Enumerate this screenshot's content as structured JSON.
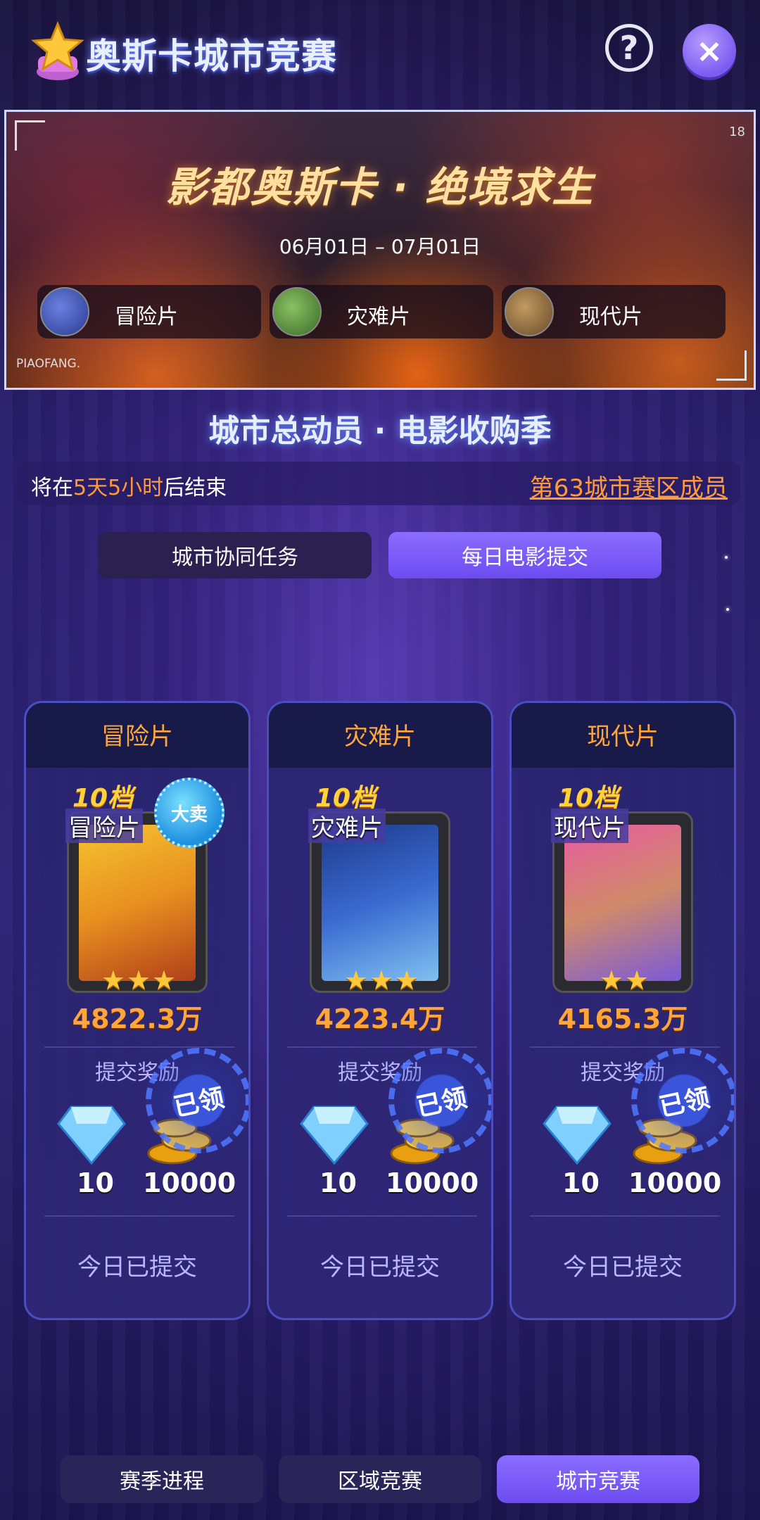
{
  "header": {
    "title": "奥斯卡城市竞赛",
    "help_icon": "?",
    "close_icon": "×"
  },
  "banner": {
    "title": "影都奥斯卡 · 绝境求生",
    "dates": "06月01日 – 07月01日",
    "age_rating": "18",
    "brand": "PIAOFANG.",
    "genres": [
      {
        "label": "冒险片",
        "thumb_color": "#3b4fb0"
      },
      {
        "label": "灾难片",
        "thumb_color": "#4a8a3a"
      },
      {
        "label": "现代片",
        "thumb_color": "#8a6a3a"
      }
    ]
  },
  "season": {
    "title": "城市总动员 · 电影收购季",
    "timer_prefix": "将在",
    "timer_highlight": "5天5小时",
    "timer_suffix": "后结束",
    "member_link": "第63城市赛区成员"
  },
  "tabs": [
    {
      "label": "城市协同任务",
      "active": false
    },
    {
      "label": "每日电影提交",
      "active": true
    }
  ],
  "cards": [
    {
      "genre": "冒险片",
      "tier": "10档",
      "poster_tag": "冒险片",
      "stars": "★★★",
      "badge": "大卖",
      "box_office": "4822.3万",
      "reward_label": "提交奖励",
      "diamonds": "10",
      "coins": "10000",
      "claimed": "已领",
      "status": "今日已提交",
      "poster_colors": [
        "#f4c430",
        "#d06a1a"
      ]
    },
    {
      "genre": "灾难片",
      "tier": "10档",
      "poster_tag": "灾难片",
      "stars": "★★★",
      "badge": "",
      "box_office": "4223.4万",
      "reward_label": "提交奖励",
      "diamonds": "10",
      "coins": "10000",
      "claimed": "已领",
      "status": "今日已提交",
      "poster_colors": [
        "#1e3a8a",
        "#4aa0e0"
      ]
    },
    {
      "genre": "现代片",
      "tier": "10档",
      "poster_tag": "现代片",
      "stars": "★★",
      "badge": "",
      "box_office": "4165.3万",
      "reward_label": "提交奖励",
      "diamonds": "10",
      "coins": "10000",
      "claimed": "已领",
      "status": "今日已提交",
      "poster_colors": [
        "#e85aa0",
        "#7a5ad8"
      ]
    }
  ],
  "bottom_nav": [
    {
      "label": "赛季进程",
      "active": false
    },
    {
      "label": "区域竞赛",
      "active": false
    },
    {
      "label": "城市竞赛",
      "active": true
    }
  ],
  "colors": {
    "accent": "#7a5cf0",
    "orange": "#ffa63a",
    "gold": "#ffd23a"
  }
}
